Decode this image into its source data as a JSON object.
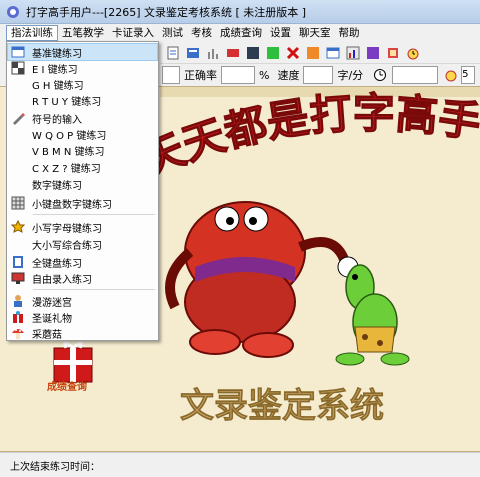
{
  "window": {
    "title": "打字高手用户---[2265]    文录鉴定考核系统 [ 未注册版本 ]"
  },
  "menubar": {
    "items": [
      {
        "label": "指法训练",
        "active": true
      },
      {
        "label": "五笔教学"
      },
      {
        "label": "卡证录入"
      },
      {
        "label": "测试"
      },
      {
        "label": "考核"
      },
      {
        "label": "成绩查询"
      },
      {
        "label": "设置"
      },
      {
        "label": "聊天室"
      },
      {
        "label": "帮助"
      }
    ]
  },
  "toolbar": {
    "icons": [
      "document-icon",
      "blue-panel-icon",
      "bars-icon",
      "red-bar-icon",
      "slate-icon",
      "green-square-icon",
      "red-x-icon",
      "orange-square-icon",
      "window-icon",
      "chart-icon",
      "purple-square-icon",
      "stamp-icon",
      "alarm-clock-icon"
    ]
  },
  "stats": {
    "accuracy_label": "正确率",
    "percent_symbol": "%",
    "speed_label": "速度",
    "speed_unit": "字/分",
    "partial_digit": "5"
  },
  "dropdown": {
    "items": [
      {
        "label": "基准键练习",
        "icon": "window-icon",
        "highlight": true
      },
      {
        "label": "E I 键练习",
        "icon": "checker-icon"
      },
      {
        "label": "G H 键练习",
        "icon": ""
      },
      {
        "label": "R T U Y 键练习",
        "icon": ""
      },
      {
        "label": "符号的输入",
        "icon": "pencil-icon"
      },
      {
        "label": "W Q O P 键练习",
        "icon": ""
      },
      {
        "label": "V B M N 键练习",
        "icon": ""
      },
      {
        "label": "C X Z ? 键练习",
        "icon": ""
      },
      {
        "label": "数字键练习",
        "icon": ""
      },
      {
        "label": "小键盘数字键练习",
        "icon": "keypad-icon"
      },
      {
        "label": "小写字母键练习",
        "icon": "star-icon"
      },
      {
        "label": "大小写综合练习",
        "icon": ""
      },
      {
        "label": "全键盘练习",
        "icon": "notebook-icon"
      },
      {
        "label": "自由录入练习",
        "icon": "monitor-icon"
      },
      {
        "label": "漫游迷宫",
        "icon": "person-icon"
      },
      {
        "label": "圣诞礼物",
        "icon": "gift-icon"
      },
      {
        "label": "采蘑菇",
        "icon": "mushroom-icon"
      }
    ]
  },
  "banner": {
    "title": "天天都是打字高手",
    "footer": "文录鉴定系统"
  },
  "grade_button": {
    "label": "成绩查询"
  },
  "statusbar": {
    "text": "上次结束练习时间："
  },
  "colors": {
    "title_gradient_top": "#cfe0f3",
    "menu_active_border": "#7a9cc6",
    "content_bg": "#f5ecd0",
    "banner_title": "#cc1f1f",
    "banner_footer": "#caa46a",
    "grade_label": "#c8440c"
  }
}
